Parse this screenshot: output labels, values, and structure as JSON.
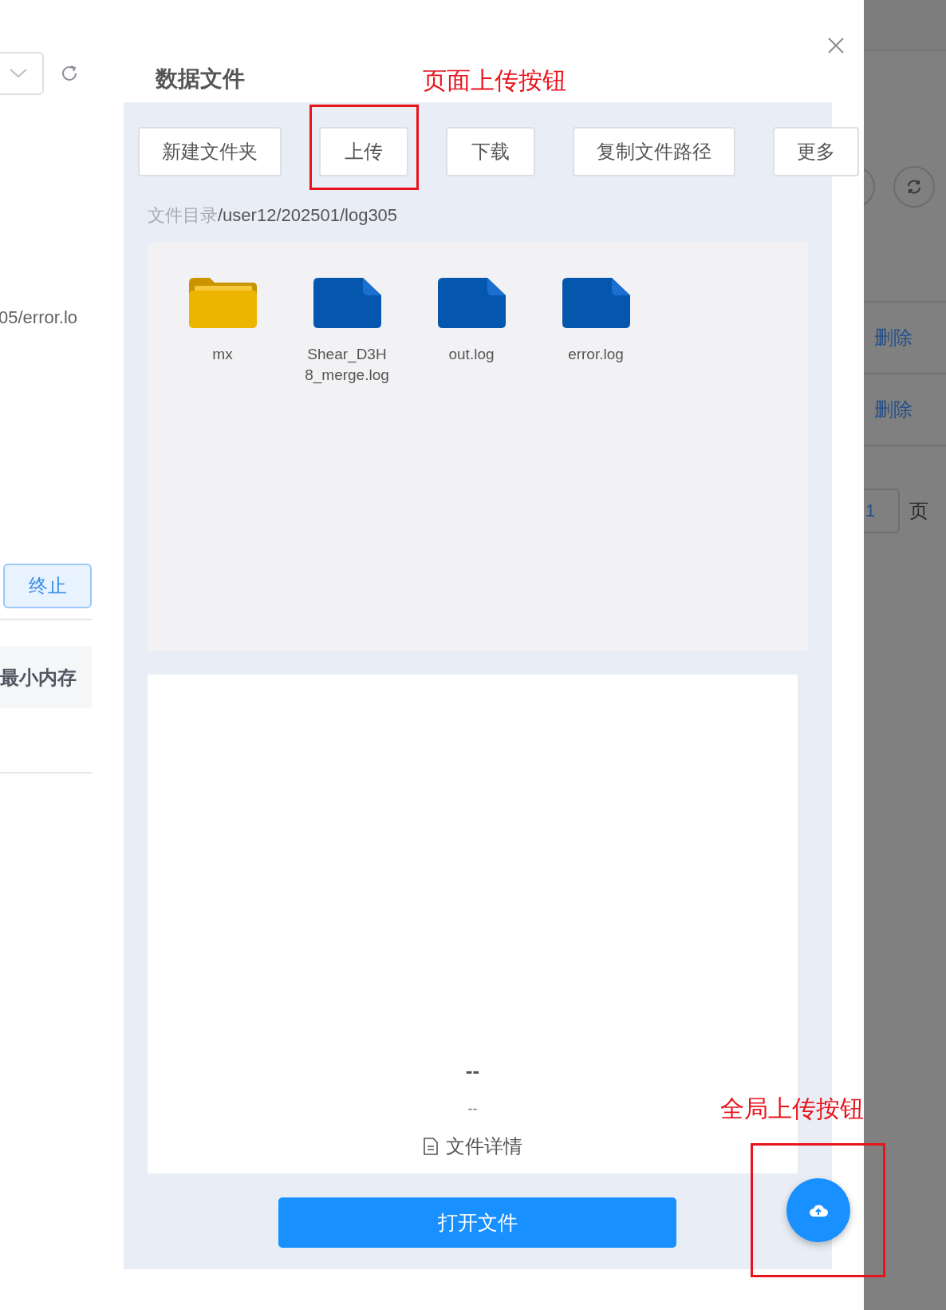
{
  "background_page": {
    "path_fragment": "05/error.lo",
    "stop_button": "终止",
    "column_header": "最小内存",
    "delete_links": [
      "删除",
      "删除"
    ],
    "pagination": {
      "page_input": "1",
      "page_label": "页"
    }
  },
  "dialog": {
    "title": "数据文件",
    "toolbar": [
      {
        "label": "新建文件夹",
        "annotated": false
      },
      {
        "label": "上传",
        "annotated": true
      },
      {
        "label": "下载",
        "annotated": false
      },
      {
        "label": "复制文件路径",
        "annotated": false
      },
      {
        "label": "更多",
        "annotated": false
      }
    ],
    "breadcrumb": {
      "label": "文件目录",
      "path": "/user12/202501/log305"
    },
    "files": [
      {
        "name": "mx",
        "kind": "folder"
      },
      {
        "name": "Shear_D3H8_merge.log",
        "kind": "file"
      },
      {
        "name": "out.log",
        "kind": "file"
      },
      {
        "name": "error.log",
        "kind": "file"
      }
    ],
    "detail": {
      "title": "--",
      "subtitle": "--",
      "link": "文件详情"
    },
    "open_button": "打开文件"
  },
  "upload_fab": {
    "annotated": true
  },
  "annotations": [
    "页面上传按钮",
    "全局上传按钮"
  ]
}
